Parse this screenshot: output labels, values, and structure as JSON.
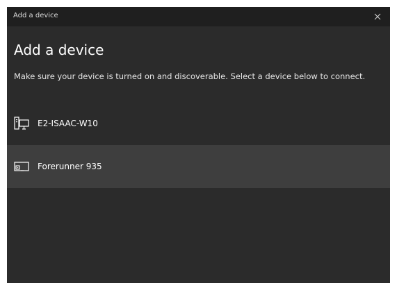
{
  "window": {
    "title": "Add a device",
    "heading": "Add a device",
    "instruction": "Make sure your device is turned on and discoverable. Select a device below to connect."
  },
  "devices": [
    {
      "label": "E2-ISAAC-W10",
      "icon": "desktop-computer-icon",
      "selected": false
    },
    {
      "label": "Forerunner 935",
      "icon": "display-device-icon",
      "selected": true
    }
  ],
  "icons": {
    "close": "close-icon"
  },
  "colors": {
    "window_background": "#2b2b2b",
    "titlebar_background": "#1f1f1f",
    "selected_row": "#3e3e3e",
    "text": "#ffffff"
  }
}
